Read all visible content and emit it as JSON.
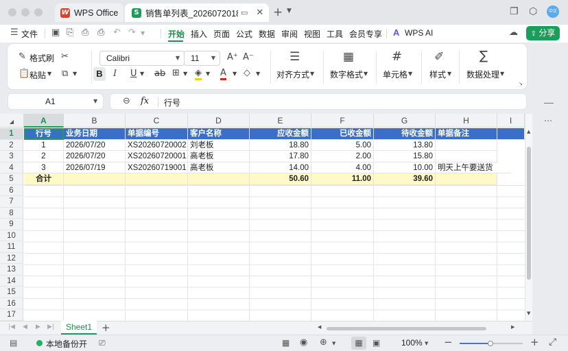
{
  "window": {
    "tabs": [
      {
        "label": "WPS Office",
        "icon": "wps-logo-icon",
        "color": "#e03e2d"
      },
      {
        "label": "销售单列表_2026072018",
        "icon": "spreadsheet-icon",
        "color": "#1b9e5a"
      }
    ],
    "avatar_label": "中文"
  },
  "menubar": {
    "file": "文件",
    "items": [
      "开始",
      "插入",
      "页面",
      "公式",
      "数据",
      "审阅",
      "视图",
      "工具",
      "会员专享"
    ],
    "active": "开始",
    "wps_ai": "WPS AI",
    "share": "分享",
    "share_color": "#1b9e5a"
  },
  "ribbon": {
    "format_painter": "格式刷",
    "paste": "粘贴",
    "font_name": "Calibri",
    "font_size": "11",
    "bold": "B",
    "italic": "I",
    "underline": "U",
    "strike": "ab",
    "align": "对齐方式",
    "number_format": "数字格式",
    "cell": "单元格",
    "style": "样式",
    "data_process": "数据处理"
  },
  "formula_bar": {
    "cell_ref": "A1",
    "fx": "fx",
    "content": "行号"
  },
  "sheet": {
    "columns": [
      "A",
      "B",
      "C",
      "D",
      "E",
      "F",
      "G",
      "H",
      "I"
    ],
    "row_numbers": [
      "1",
      "2",
      "3",
      "4",
      "5",
      "6",
      "7",
      "8",
      "9",
      "10",
      "11",
      "12",
      "13",
      "14",
      "15",
      "16",
      "17"
    ],
    "header": [
      "行号",
      "业务日期",
      "单据编号",
      "客户名称",
      "应收金额",
      "已收金额",
      "待收金额",
      "单据备注"
    ],
    "rows": [
      [
        "1",
        "2026/07/20",
        "XS20260720002",
        "刘老板",
        "18.80",
        "5.00",
        "13.80",
        ""
      ],
      [
        "2",
        "2026/07/20",
        "XS20260720001",
        "高老板",
        "17.80",
        "2.00",
        "15.80",
        ""
      ],
      [
        "3",
        "2026/07/19",
        "XS20260719001",
        "高老板",
        "14.00",
        "4.00",
        "10.00",
        "明天上午要送货"
      ]
    ],
    "total": [
      "合计",
      "",
      "",
      "",
      "50.60",
      "11.00",
      "39.60",
      ""
    ],
    "header_color": "#3a6fc7",
    "total_color": "#fff9c8"
  },
  "sheet_tabs": {
    "active": "Sheet1"
  },
  "statusbar": {
    "backup": "本地备份开",
    "zoom": "100%"
  }
}
